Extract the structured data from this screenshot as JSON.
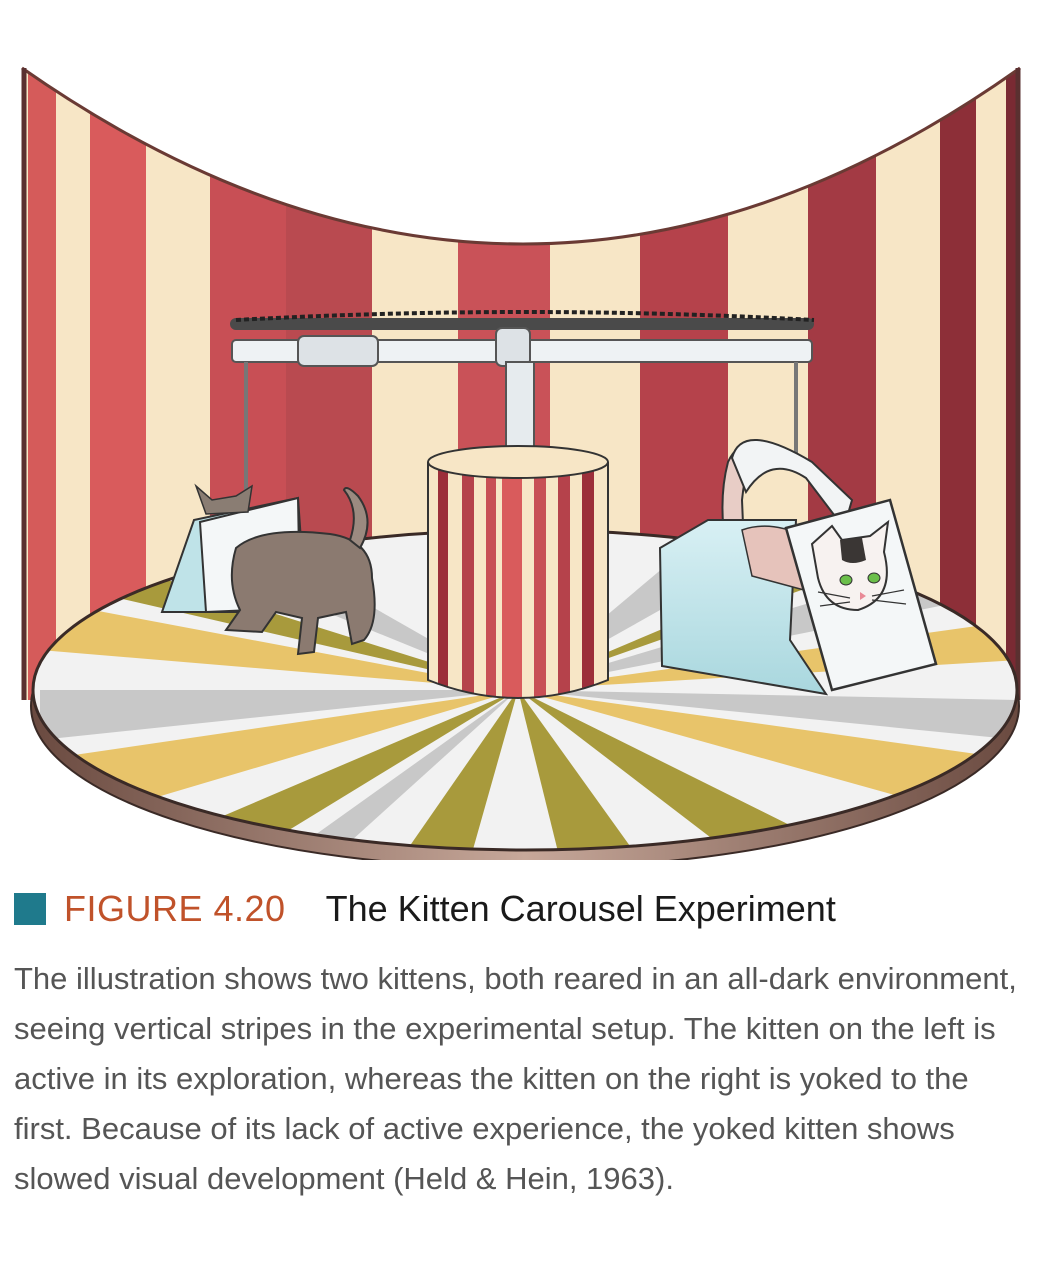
{
  "figure": {
    "label": "FIGURE 4.20",
    "title": "The Kitten Carousel Experiment",
    "marker_color": "#1f7a8c",
    "label_color": "#c0522a"
  },
  "caption": {
    "text": "The illustration shows two kittens, both reared in an all-dark environment, seeing vertical stripes in the experimental setup. The kitten on the left is active in its exploration, whereas the kitten on the right is yoked to the first. Because of its lack of active experience, the yoked kitten shows slowed visual development (Held & Hein, 1963)."
  },
  "illustration": {
    "stripe_colors": [
      "#c9524e",
      "#f7e6c6"
    ],
    "floor_colors": [
      "#a89a3c",
      "#c8c8c8",
      "#e8c46a",
      "#f2f2f2"
    ],
    "icons": [
      "striped-drum-wall",
      "carousel-platform",
      "striped-center-post",
      "crossbar",
      "active-kitten",
      "yoked-kitten",
      "gondola-basket"
    ]
  }
}
